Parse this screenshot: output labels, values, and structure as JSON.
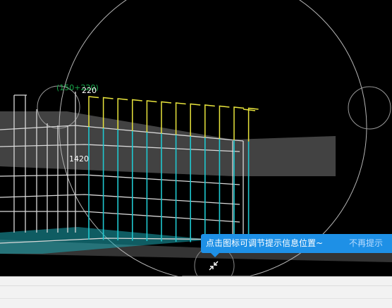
{
  "dimensions": {
    "top_width_label": "220",
    "top_formula_label": "(150+220)",
    "side_height_label": "1420"
  },
  "tooltip": {
    "message": "点击图标可调节提示信息位置~",
    "dismiss_label": "不再提示"
  },
  "colors": {
    "background": "#000000",
    "rebar_cyan": "#1fc7cf",
    "rebar_yellow": "#e8e43c",
    "frame_white": "#e8e8e8",
    "slab_gray": "#5a5a5a",
    "formula_green": "#18a84a",
    "tooltip_blue": "#1e90e6"
  },
  "icons": {
    "pin_handle": "collapse-arrows-icon"
  }
}
